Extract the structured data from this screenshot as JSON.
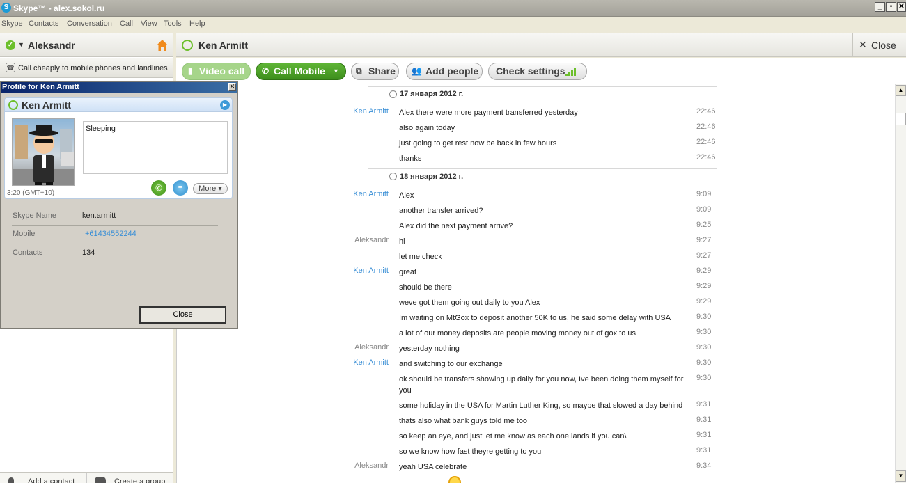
{
  "window": {
    "title": "Skype™ - alex.sokol.ru",
    "controls": [
      "_",
      "▫",
      "✕"
    ]
  },
  "menu": [
    "Skype",
    "Contacts",
    "Conversation",
    "Call",
    "View",
    "Tools",
    "Help"
  ],
  "sidebar": {
    "user_name": "Aleksandr",
    "promo_text": "Call cheaply to mobile phones and landlines",
    "add_contact": "Add a contact",
    "create_group": "Create a group"
  },
  "profile_popup": {
    "title": "Profile for Ken Armitt",
    "name": "Ken Armitt",
    "mood": "Sleeping",
    "local_time": "3:20 (GMT+10)",
    "more_label": "More ▾",
    "details": [
      {
        "label": "Skype Name",
        "value": "ken.armitt"
      },
      {
        "label": "Mobile",
        "value": "+61434552244"
      },
      {
        "label": "Contacts",
        "value": "134"
      }
    ],
    "close_label": "Close"
  },
  "conversation": {
    "contact_name": "Ken Armitt",
    "close_label": "Close",
    "toolbar": {
      "video_call": "Video call",
      "call_mobile": "Call Mobile",
      "share": "Share",
      "add_people": "Add people",
      "check_settings": "Check settings"
    },
    "dates": [
      "17 января 2012 г.",
      "18 января 2012 г."
    ],
    "messages": [
      {
        "sender": "Ken Armitt",
        "text": "Alex there were more payment transferred yesterday",
        "time": "22:46"
      },
      {
        "sender": "",
        "text": "also again today",
        "time": "22:46"
      },
      {
        "sender": "",
        "text": "just going to get rest now be back in few hours",
        "time": "22:46"
      },
      {
        "sender": "",
        "text": "thanks",
        "time": "22:46"
      },
      {
        "sender": "Ken Armitt",
        "text": "Alex",
        "time": "9:09"
      },
      {
        "sender": "",
        "text": "another transfer arrived?",
        "time": "9:09"
      },
      {
        "sender": "",
        "text": "Alex did the next payment arrive?",
        "time": "9:25"
      },
      {
        "sender": "Aleksandr",
        "text": "hi",
        "time": "9:27"
      },
      {
        "sender": "",
        "text": "let me check",
        "time": "9:27"
      },
      {
        "sender": "Ken Armitt",
        "text": "great",
        "time": "9:29"
      },
      {
        "sender": "",
        "text": "should be there",
        "time": "9:29"
      },
      {
        "sender": "",
        "text": "weve got them going out daily to you Alex",
        "time": "9:29"
      },
      {
        "sender": "",
        "text": "Im waiting on MtGox to deposit another 50K to us, he said some delay with USA",
        "time": "9:30"
      },
      {
        "sender": "",
        "text": "a lot of our money deposits are people moving money out of gox to us",
        "time": "9:30"
      },
      {
        "sender": "Aleksandr",
        "text": "yesterday nothing",
        "time": "9:30"
      },
      {
        "sender": "Ken Armitt",
        "text": "and switching to our exchange",
        "time": "9:30"
      },
      {
        "sender": "",
        "text": "ok should be transfers showing up daily for you now, Ive been doing them myself for you",
        "time": "9:30"
      },
      {
        "sender": "",
        "text": "some holiday in the USA for Martin Luther King, so maybe that slowed a day behind",
        "time": "9:31"
      },
      {
        "sender": "",
        "text": "thats also what bank guys told me too",
        "time": "9:31"
      },
      {
        "sender": "",
        "text": "so keep an eye, and just let me know as each one lands if you can\\",
        "time": "9:31"
      },
      {
        "sender": "",
        "text": "so we know how fast theyre getting to you",
        "time": "9:31"
      },
      {
        "sender": "Aleksandr",
        "text": "yeah USA celebrate",
        "time": "9:34"
      }
    ]
  }
}
